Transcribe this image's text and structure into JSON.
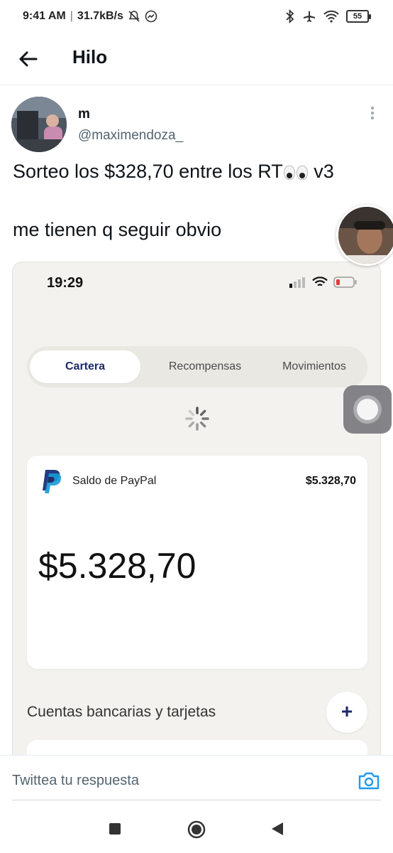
{
  "status_bar": {
    "time": "9:41 AM",
    "speed": "31.7kB/s",
    "battery": "55"
  },
  "header": {
    "title": "Hilo"
  },
  "tweet": {
    "name": "m",
    "handle": "@maximendoza_",
    "line1_text": "Sorteo los $328,70 entre los RT",
    "line1_suffix": "v3",
    "line2_text": "me tienen q seguir obvio"
  },
  "embedded_screenshot": {
    "time": "19:29",
    "tabs": [
      "Cartera",
      "Recompensas",
      "Movimientos"
    ],
    "card_label": "Saldo de PayPal",
    "card_amount_small": "$5.328,70",
    "card_amount_big": "$5.328,70",
    "bank_section_label": "Cuentas bancarias y tarjetas",
    "add_button": "+"
  },
  "reply": {
    "placeholder": "Twittea tu respuesta"
  },
  "icons": {
    "back": "arrow-left-icon",
    "camera": "camera-icon",
    "more": "more-vertical-icon"
  },
  "colors": {
    "paypal_navy": "#1b2a6b",
    "twitter_blue": "#1d9bf0"
  }
}
